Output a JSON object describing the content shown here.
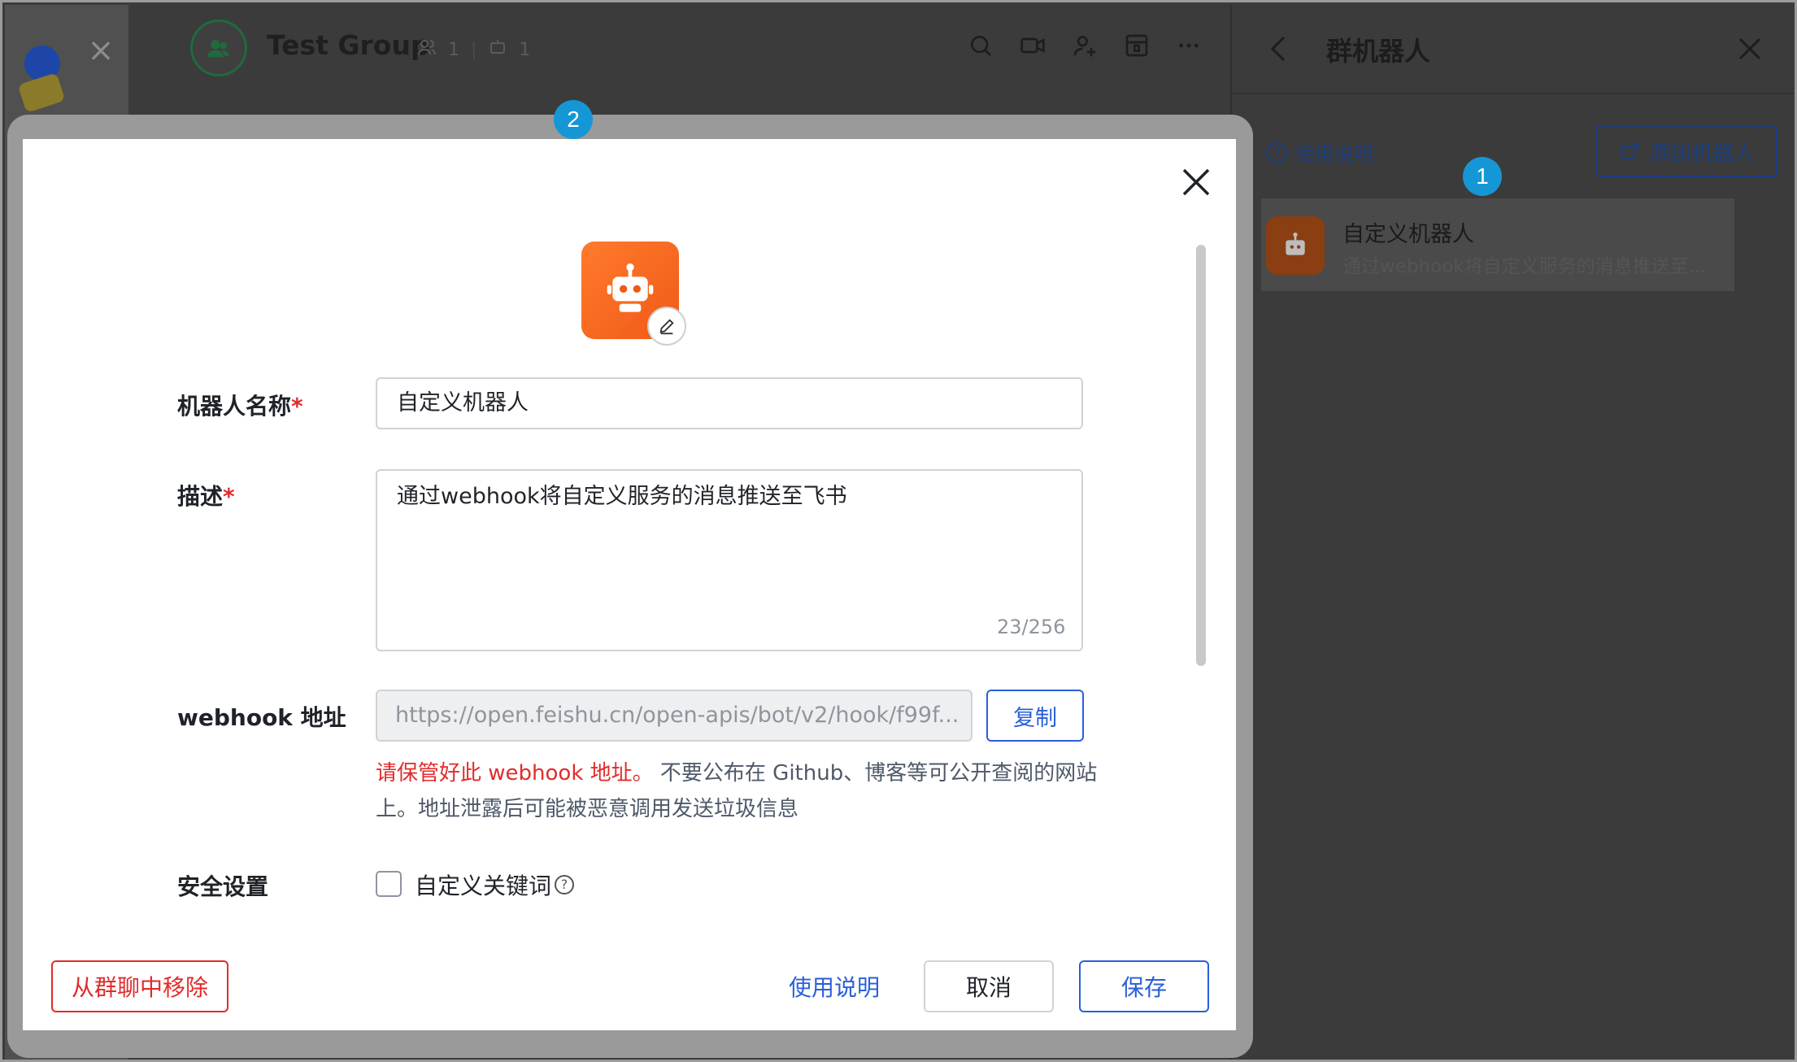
{
  "chat": {
    "title": "Test Group",
    "member_count": "1",
    "bot_count": "1"
  },
  "right_panel": {
    "title": "群机器人",
    "help_label": "使用说明",
    "add_button_label": "添加机器人",
    "bot_item": {
      "name": "自定义机器人",
      "description": "通过webhook将自定义服务的消息推送至..."
    }
  },
  "badges": {
    "step1": "1",
    "step2": "2"
  },
  "modal": {
    "name_label": "机器人名称",
    "name_value": "自定义机器人",
    "desc_label": "描述",
    "desc_value": "通过webhook将自定义服务的消息推送至飞书",
    "desc_count": "23/256",
    "required_mark": "*",
    "webhook_label": "webhook 地址",
    "webhook_value": "https://open.feishu.cn/open-apis/bot/v2/hook/f99f...",
    "copy_label": "复制",
    "warning_red": "请保管好此 webhook 地址。",
    "warning_rest": " 不要公布在 Github、博客等可公开查阅的网站上。地址泄露后可能被恶意调用发送垃圾信息",
    "security_label": "安全设置",
    "keyword_label": "自定义关键词",
    "remove_label": "从群聊中移除",
    "help_label": "使用说明",
    "cancel_label": "取消",
    "save_label": "保存"
  },
  "colors": {
    "accent": "#2a5fd9",
    "danger": "#e22b2b",
    "bot_orange": "#f05a17",
    "badge": "#1597d6"
  }
}
